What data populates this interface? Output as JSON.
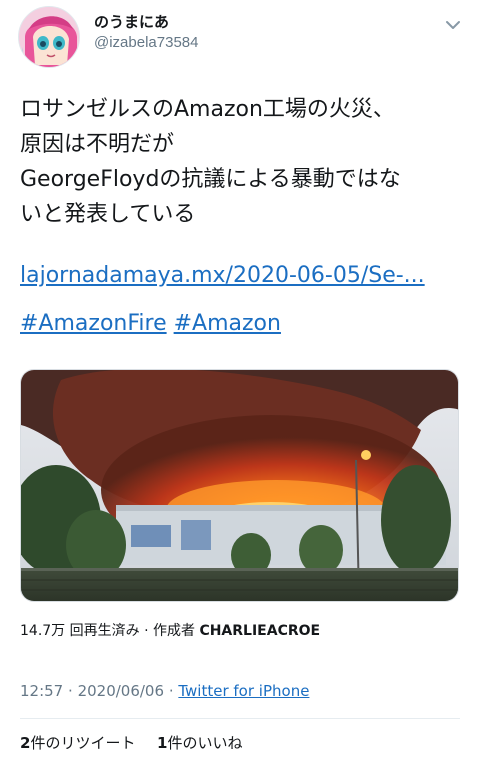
{
  "user": {
    "display_name": "のうまにあ",
    "handle": "@izabela73584",
    "avatar_icon": "anime-avatar-icon",
    "menu_icon": "chevron-down-icon"
  },
  "tweet": {
    "text_lines": [
      "ロサンゼルスのAmazon工場の火災、",
      "原因は不明だが",
      "GeorgeFloydの抗議による暴動ではな",
      "いと発表している"
    ],
    "link": "lajornadamaya.mx/2020-06-05/Se-...",
    "hashtags": [
      "#AmazonFire",
      "#Amazon"
    ]
  },
  "media": {
    "icon": "video-thumbnail-fire-icon",
    "views_count": "14.7万",
    "views_label": "回再生済み · 作成者",
    "creator": "CHARLIEACROE"
  },
  "meta": {
    "time": "12:57",
    "date": "2020/06/06",
    "source": "Twitter for iPhone"
  },
  "stats": {
    "retweets_count": "2",
    "retweets_label": "件のリツイート",
    "likes_count": "1",
    "likes_label": "件のいいね"
  },
  "colors": {
    "link": "#1b6ec2",
    "secondary_text": "#657786",
    "primary_text": "#14171a"
  }
}
